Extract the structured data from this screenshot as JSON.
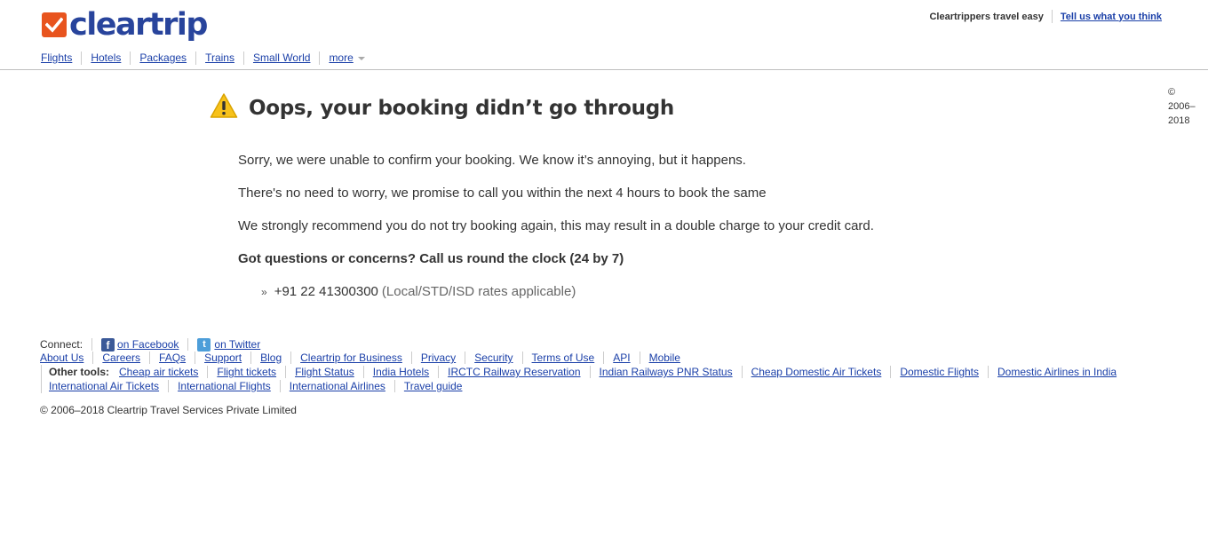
{
  "header": {
    "logo_text": "cleartrip",
    "tagline": "Cleartrippers travel easy",
    "feedback_link": "Tell us what you think",
    "brand_color": "#e8541e",
    "logo_color": "#28449c"
  },
  "nav": {
    "items": [
      "Flights",
      "Hotels",
      "Packages",
      "Trains",
      "Small World",
      "more"
    ]
  },
  "main": {
    "heading": "Oops, your booking didn’t go through",
    "icon": "warning-icon",
    "paragraphs": [
      "Sorry, we were unable to confirm your booking. We know it’s annoying, but it happens.",
      "There's no need to worry, we promise to call you within the next 4 hours to book the same",
      "We strongly recommend you do not try booking again, this may result in a double charge to your credit card.",
      "Got questions or concerns? Call us round the clock (24 by 7)"
    ],
    "phone_bullet": "»",
    "phone_number": "+91 22 41300300",
    "phone_note": "(Local/STD/ISD rates applicable)"
  },
  "side_copyright": {
    "symbol": "©",
    "years_line1": "2006–",
    "years_line2": "2018"
  },
  "footer": {
    "connect_label": "Connect:",
    "facebook_label": "on Facebook",
    "twitter_label": "on Twitter",
    "links": [
      "About Us",
      "Careers",
      "FAQs",
      "Support",
      "Blog",
      "Cleartrip for Business",
      "Privacy",
      "Security",
      "Terms of Use",
      "API",
      "Mobile"
    ],
    "other_tools_label": "Other tools:",
    "other_tools_row1": [
      "Cheap air tickets",
      "Flight tickets",
      "Flight Status",
      "India Hotels",
      "IRCTC Railway Reservation",
      "Indian Railways PNR Status",
      "Cheap Domestic Air Tickets",
      "Domestic Flights ",
      "Domestic Airlines in India"
    ],
    "other_tools_row2": [
      "International Air Tickets",
      "International Flights ",
      "International Airlines",
      "Travel guide"
    ],
    "copyright": "© 2006–2018 Cleartrip Travel Services Private Limited"
  }
}
